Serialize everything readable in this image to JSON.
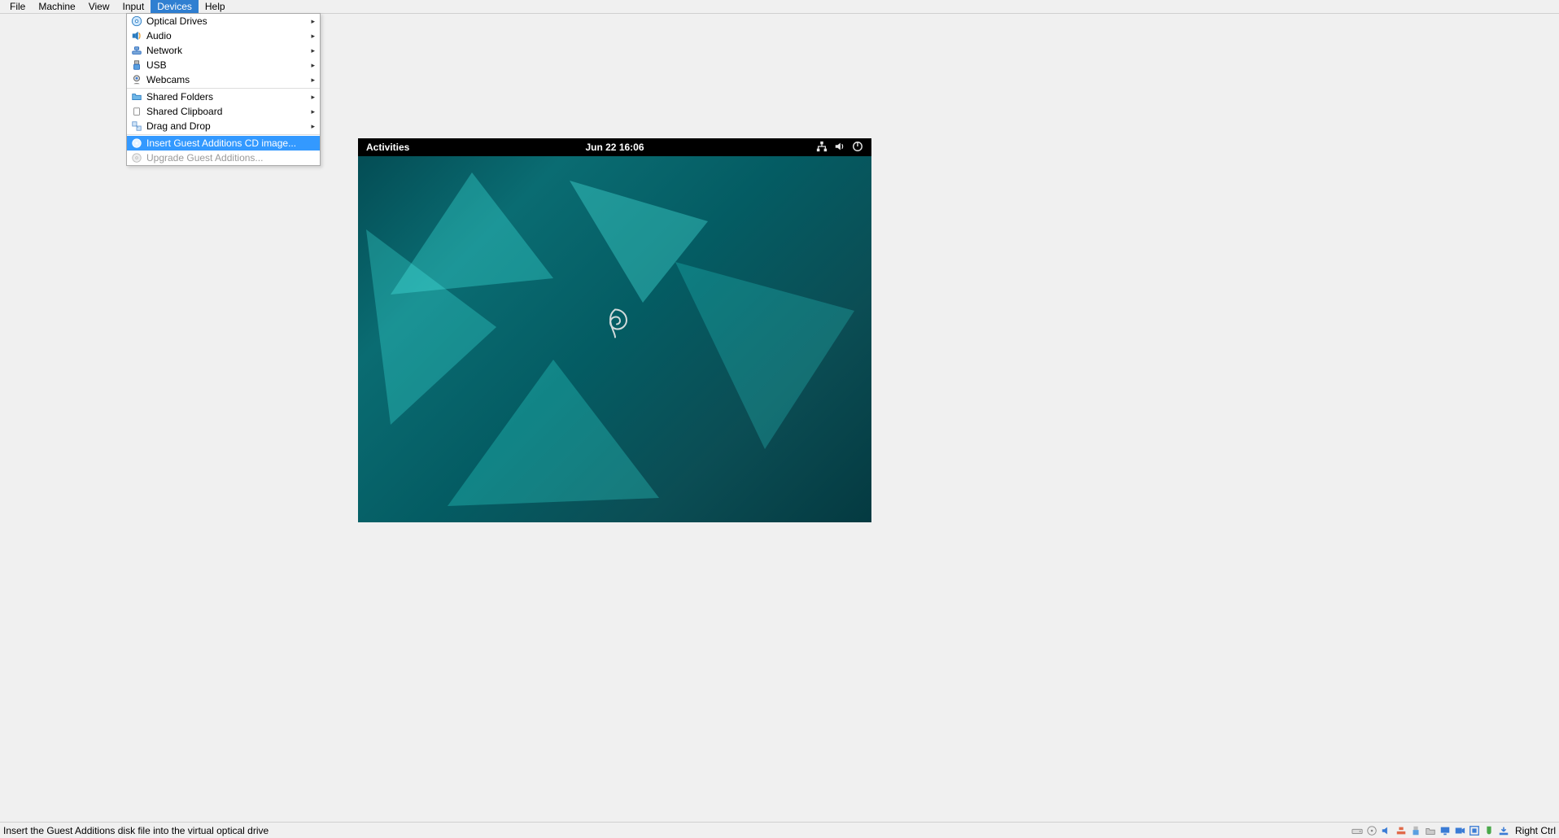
{
  "menubar": {
    "items": [
      {
        "label": "File"
      },
      {
        "label": "Machine"
      },
      {
        "label": "View"
      },
      {
        "label": "Input"
      },
      {
        "label": "Devices",
        "active": true
      },
      {
        "label": "Help"
      }
    ]
  },
  "devices_menu": {
    "items": [
      {
        "label": "Optical Drives",
        "icon": "disc",
        "submenu": true
      },
      {
        "label": "Audio",
        "icon": "audio",
        "submenu": true
      },
      {
        "label": "Network",
        "icon": "network",
        "submenu": true
      },
      {
        "label": "USB",
        "icon": "usb",
        "submenu": true
      },
      {
        "label": "Webcams",
        "icon": "webcam",
        "submenu": true
      },
      {
        "sep": true
      },
      {
        "label": "Shared Folders",
        "icon": "folder",
        "submenu": true
      },
      {
        "label": "Shared Clipboard",
        "icon": "clipboard",
        "submenu": true
      },
      {
        "label": "Drag and Drop",
        "icon": "drag",
        "submenu": true
      },
      {
        "sep": true
      },
      {
        "label": "Insert Guest Additions CD image...",
        "icon": "disc-insert",
        "highlight": true
      },
      {
        "label": "Upgrade Guest Additions...",
        "icon": "disc-upgrade",
        "disabled": true
      }
    ]
  },
  "vm": {
    "activities": "Activities",
    "datetime": "Jun 22  16:06"
  },
  "statusbar": {
    "text": "Insert the Guest Additions disk file into the virtual optical drive",
    "hostkey": "Right Ctrl"
  }
}
